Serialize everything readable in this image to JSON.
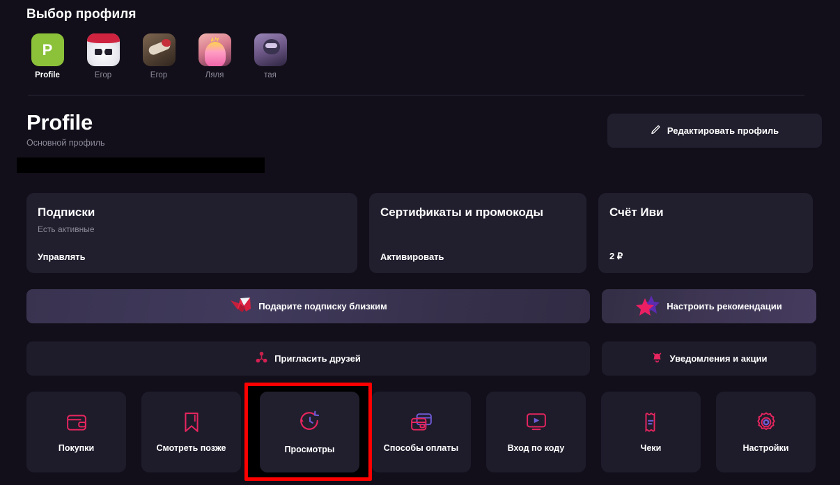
{
  "colors": {
    "page_bg": "#120f1a",
    "card_bg": "#211f2e",
    "tile_bg": "#1e1c2b",
    "accent_pink": "#e8255f",
    "accent_purple": "#6f5ad6",
    "muted_text": "#8d8a99",
    "highlight_red": "#ff0000",
    "profile_avatar_green": "#8cc13a"
  },
  "chooser": {
    "title": "Выбор профиля",
    "profiles": [
      {
        "label": "Profile",
        "icon": "avatar-letter-p",
        "initial": "P",
        "active": true
      },
      {
        "label": "Егор",
        "icon": "avatar-panda",
        "active": false
      },
      {
        "label": "Егор",
        "icon": "avatar-dog",
        "active": false
      },
      {
        "label": "Ляля",
        "icon": "avatar-girl",
        "active": false
      },
      {
        "label": "тая",
        "icon": "avatar-taya",
        "active": false
      }
    ]
  },
  "header": {
    "title": "Profile",
    "subtitle": "Основной профиль",
    "redacted_bar": true,
    "edit_button": {
      "label": "Редактировать профиль",
      "icon": "pencil-icon"
    }
  },
  "info_cards": [
    {
      "title": "Подписки",
      "note": "Есть активные",
      "action": "Управлять"
    },
    {
      "title": "Сертификаты и промокоды",
      "note": "",
      "action": "Активировать"
    },
    {
      "title": "Счёт Иви",
      "note": "",
      "action": "2 ₽"
    }
  ],
  "banners": [
    {
      "label": "Подарите подписку близким",
      "icon": "gift-ribbon-icon",
      "style": "gradient-gift",
      "width": "wide"
    },
    {
      "label": "Настроить рекомендации",
      "icon": "double-star-icon",
      "style": "gradient-reco",
      "width": "narrow"
    },
    {
      "label": "Пригласить друзей",
      "icon": "invite-friends-icon",
      "style": "flat",
      "width": "wide"
    },
    {
      "label": "Уведомления и акции",
      "icon": "bell-icon",
      "style": "flat",
      "width": "narrow"
    }
  ],
  "tiles": [
    {
      "label": "Покупки",
      "icon": "wallet-icon",
      "highlighted": false
    },
    {
      "label": "Смотреть позже",
      "icon": "bookmark-icon",
      "highlighted": false
    },
    {
      "label": "Просмотры",
      "icon": "history-clock-icon",
      "highlighted": true
    },
    {
      "label": "Способы оплаты",
      "icon": "credit-cards-icon",
      "highlighted": false
    },
    {
      "label": "Вход по коду",
      "icon": "tv-play-icon",
      "highlighted": false
    },
    {
      "label": "Чеки",
      "icon": "receipt-icon",
      "highlighted": false
    },
    {
      "label": "Настройки",
      "icon": "gear-icon",
      "highlighted": false
    }
  ]
}
